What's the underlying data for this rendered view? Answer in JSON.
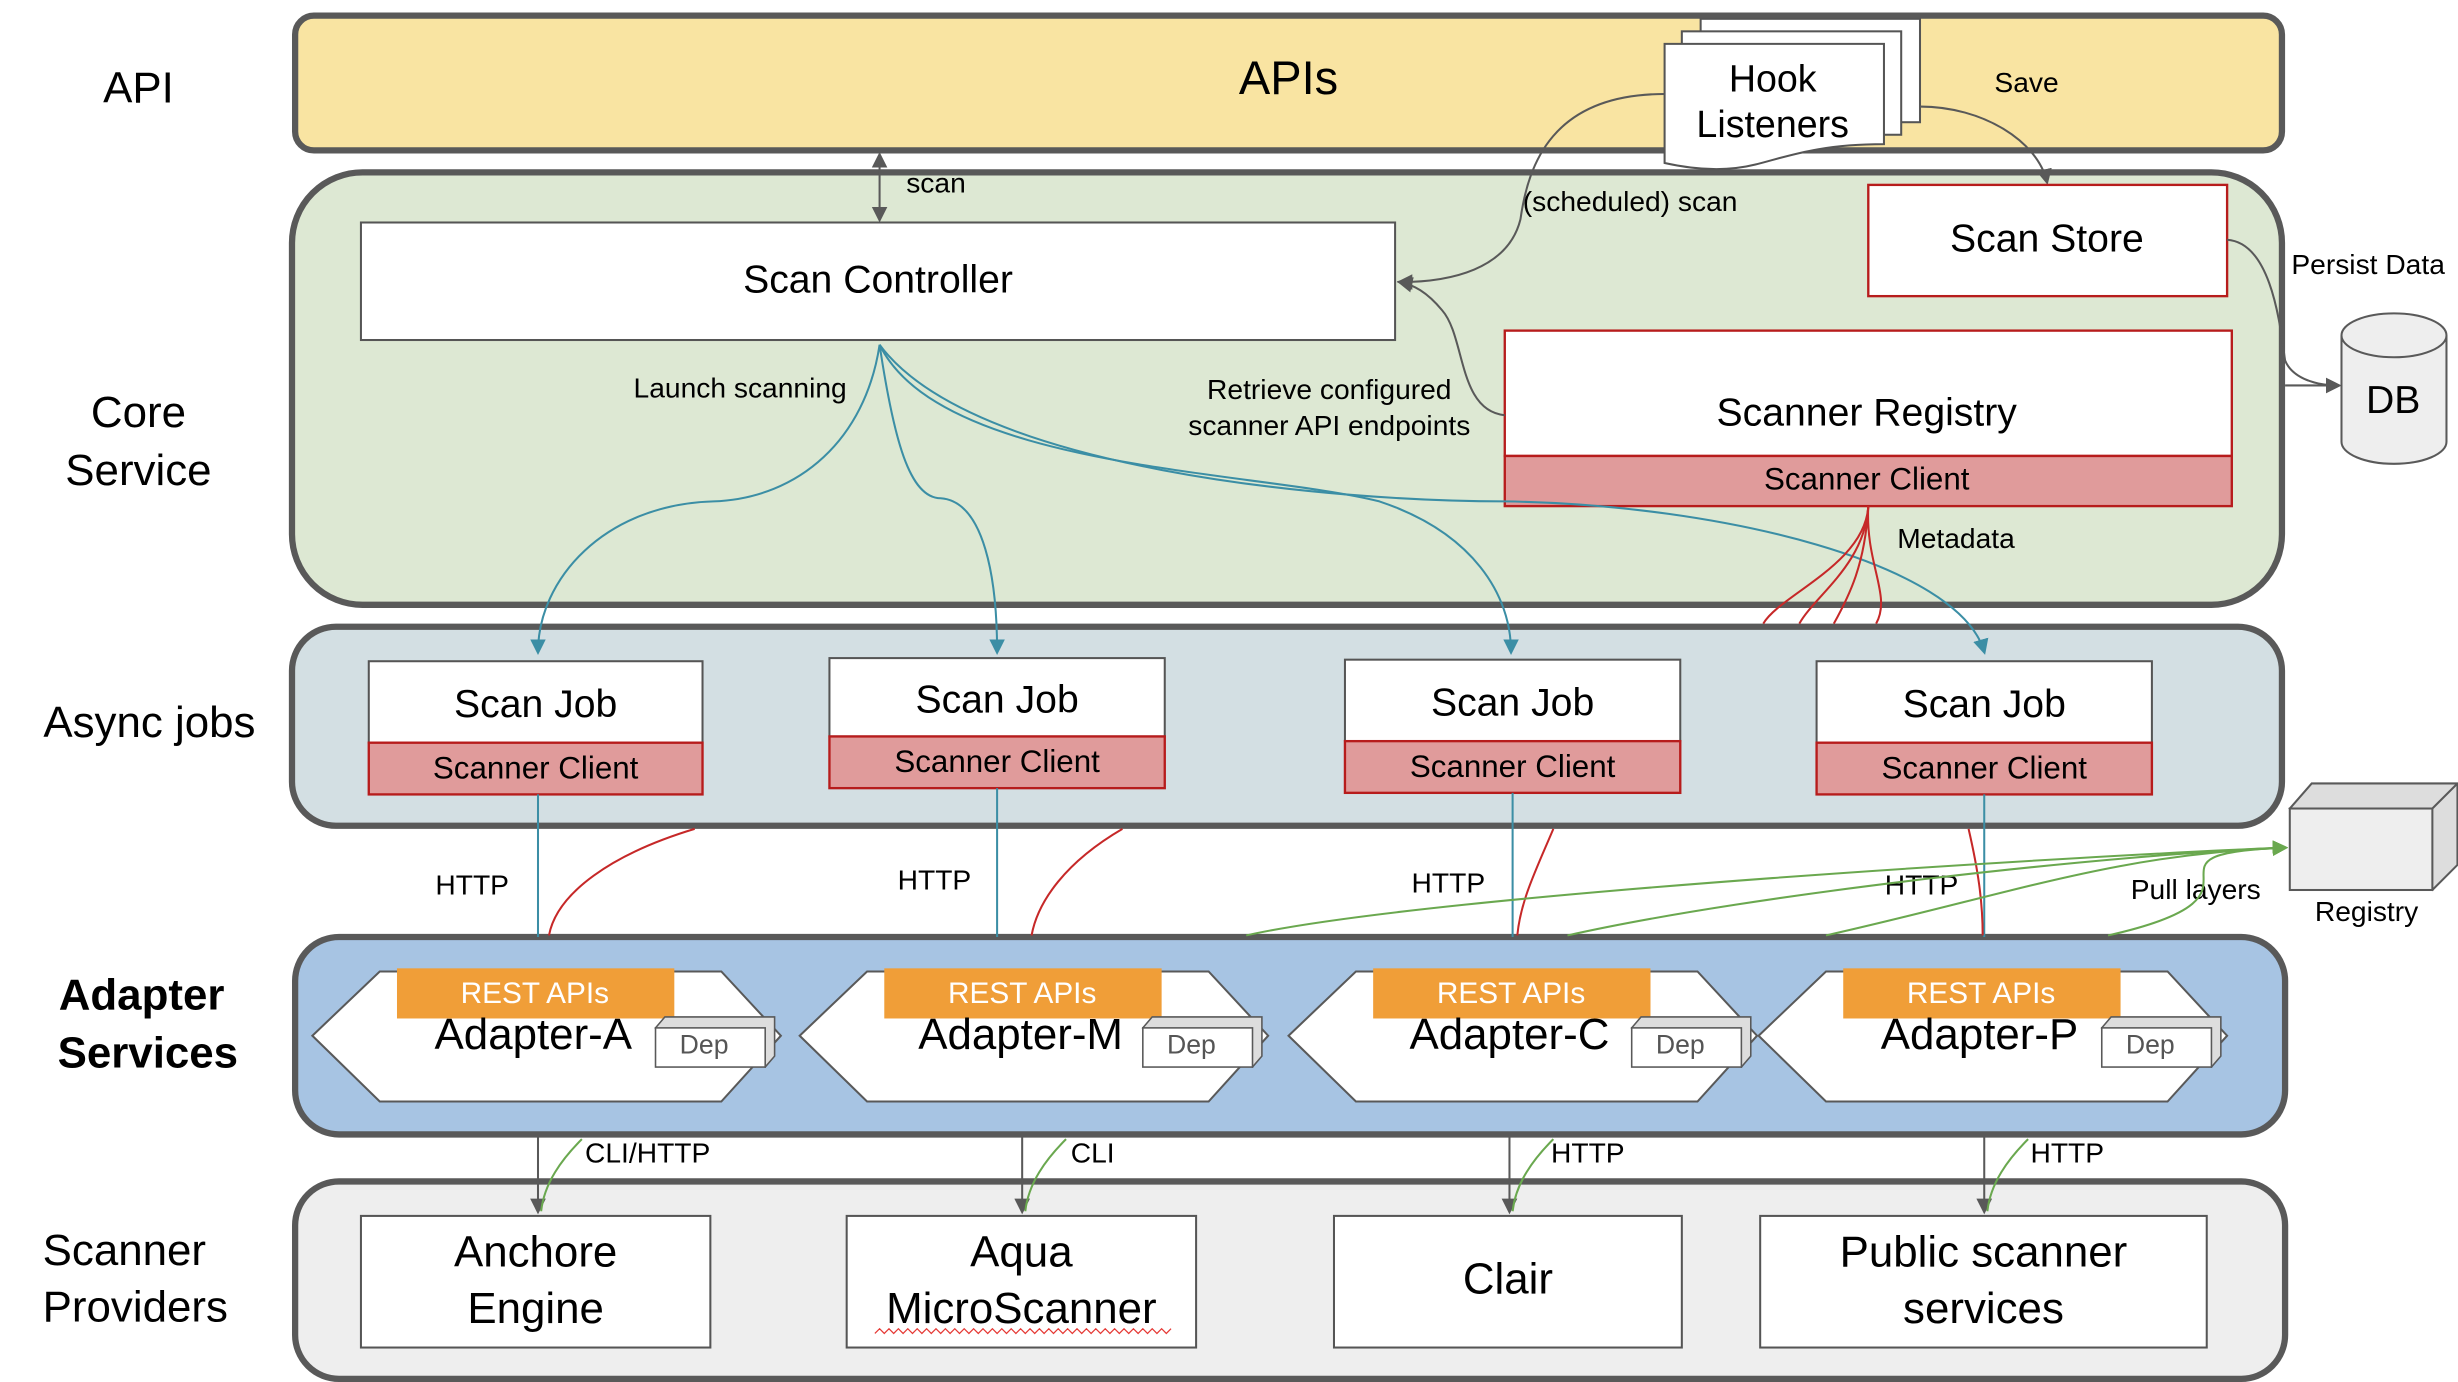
{
  "layers": {
    "api": "API",
    "core_line1": "Core",
    "core_line2": "Service",
    "async": "Async jobs",
    "adapter_line1": "Adapter",
    "adapter_line2": "Services",
    "providers_line1": "Scanner",
    "providers_line2": "Providers"
  },
  "api_band": {
    "title": "APIs",
    "hook_line1": "Hook",
    "hook_line2": "Listeners",
    "save_label": "Save"
  },
  "core": {
    "scan_label": "scan",
    "scan_controller": "Scan Controller",
    "scheduled_scan": "(scheduled) scan",
    "scan_store": "Scan Store",
    "persist_data": "Persist Data",
    "db": "DB",
    "scanner_registry": "Scanner Registry",
    "scanner_client": "Scanner Client",
    "retrieve_line1": "Retrieve configured",
    "retrieve_line2": "scanner API endpoints",
    "launch_scanning": "Launch scanning",
    "metadata": "Metadata"
  },
  "jobs": [
    {
      "title": "Scan Job",
      "client": "Scanner Client",
      "protocol": "HTTP"
    },
    {
      "title": "Scan Job",
      "client": "Scanner Client",
      "protocol": "HTTP"
    },
    {
      "title": "Scan Job",
      "client": "Scanner Client",
      "protocol": "HTTP"
    },
    {
      "title": "Scan Job",
      "client": "Scanner Client",
      "protocol": "HTTP"
    }
  ],
  "registry": {
    "label": "Registry",
    "pull_layers": "Pull layers"
  },
  "adapters": [
    {
      "name": "Adapter-A",
      "api": "REST APIs",
      "dep": "Dep",
      "protocol": "CLI/HTTP"
    },
    {
      "name": "Adapter-M",
      "api": "REST APIs",
      "dep": "Dep",
      "protocol": "CLI"
    },
    {
      "name": "Adapter-C",
      "api": "REST APIs",
      "dep": "Dep",
      "protocol": "HTTP"
    },
    {
      "name": "Adapter-P",
      "api": "REST APIs",
      "dep": "Dep",
      "protocol": "HTTP"
    }
  ],
  "providers": [
    {
      "line1": "Anchore",
      "line2": "Engine"
    },
    {
      "line1": "Aqua",
      "line2": "MicroScanner"
    },
    {
      "line1": "Clair",
      "line2": ""
    },
    {
      "line1": "Public scanner",
      "line2": "services"
    }
  ],
  "colors": {
    "api_band": "#f9e4a2",
    "core_band": "#dde8d3",
    "async_band": "#d3dfe3",
    "adapter_band": "#a7c4e3",
    "provider_band": "#eeeeee",
    "scanner_client": "#e09b9b",
    "rest_api": "#f09e38"
  }
}
